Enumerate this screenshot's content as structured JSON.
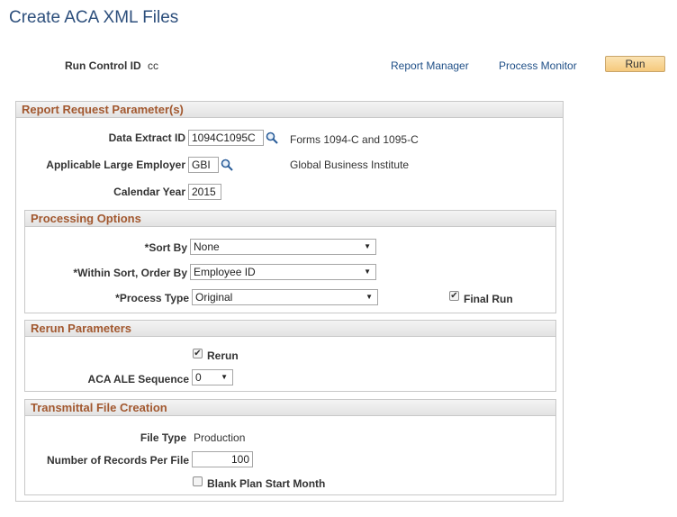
{
  "page_title": "Create ACA XML Files",
  "run_control": {
    "label": "Run Control ID",
    "value": "cc"
  },
  "links": {
    "report_manager": "Report Manager",
    "process_monitor": "Process Monitor"
  },
  "run_button": "Run",
  "report_request": {
    "header": "Report Request Parameter(s)",
    "data_extract_id": {
      "label": "Data Extract ID",
      "value": "1094C1095C",
      "description": "Forms 1094-C and 1095-C"
    },
    "employer": {
      "label": "Applicable Large Employer",
      "value": "GBI",
      "description": "Global Business Institute"
    },
    "calendar_year": {
      "label": "Calendar Year",
      "value": "2015"
    }
  },
  "processing": {
    "header": "Processing Options",
    "sort_by": {
      "label": "*Sort By",
      "value": "None"
    },
    "order_by": {
      "label": "*Within Sort, Order By",
      "value": "Employee ID"
    },
    "process_type": {
      "label": "*Process Type",
      "value": "Original"
    },
    "final_run": {
      "label": "Final Run",
      "checked": true
    }
  },
  "rerun": {
    "header": "Rerun Parameters",
    "rerun": {
      "label": "Rerun",
      "checked": true
    },
    "sequence": {
      "label": "ACA ALE Sequence",
      "value": "0"
    }
  },
  "transmittal": {
    "header": "Transmittal File Creation",
    "file_type": {
      "label": "File Type",
      "value": "Production"
    },
    "records": {
      "label": "Number of Records Per File",
      "value": "100"
    },
    "blank_plan": {
      "label": "Blank Plan Start Month",
      "checked": false
    }
  },
  "colors": {
    "title": "#2d4f7c",
    "section_header_text": "#a2582f",
    "link": "#1f4f87",
    "run_button": "#f5c97c"
  },
  "icons": {
    "lookup": "magnifier-icon",
    "dropdown": "chevron-down-icon",
    "checkbox": "checkmark-icon"
  }
}
